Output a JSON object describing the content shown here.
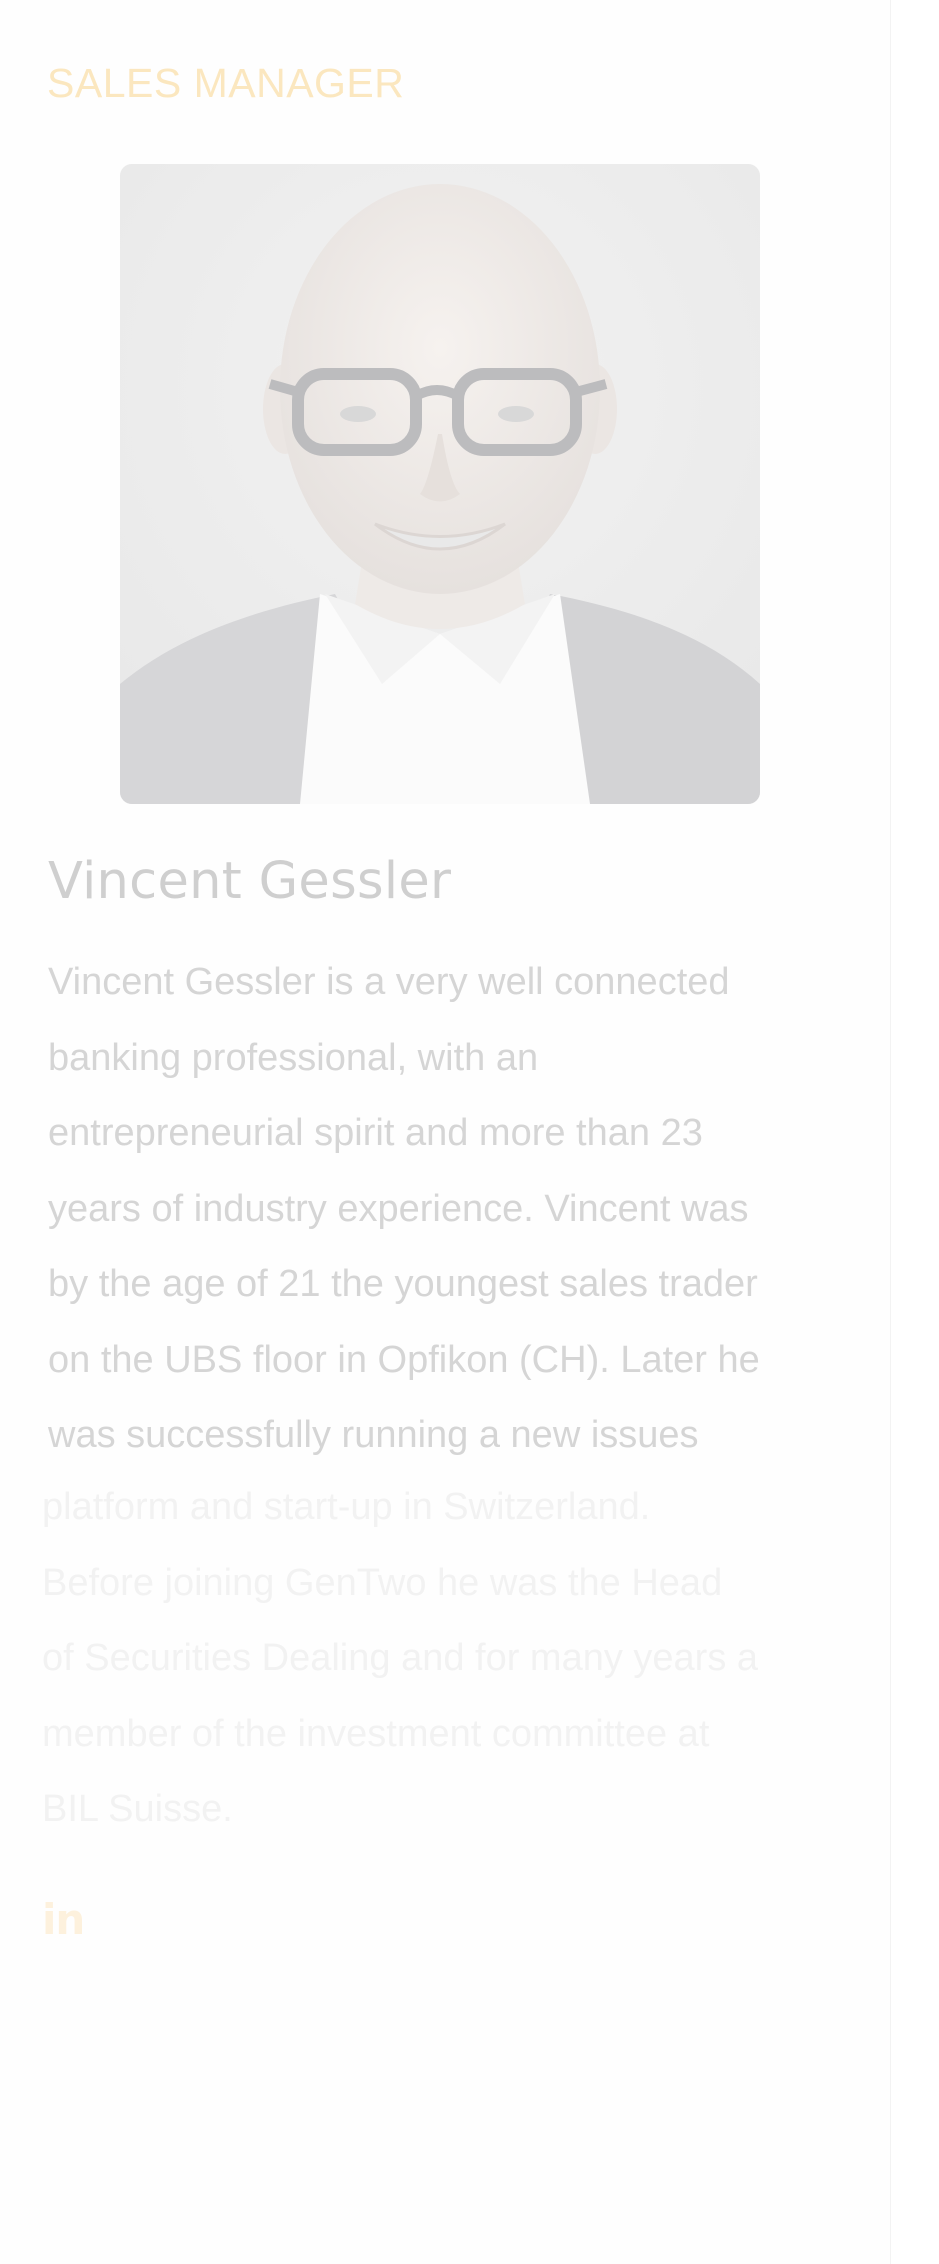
{
  "profile": {
    "role": "SALES MANAGER",
    "name": "Vincent Gessler",
    "photo_icon": "portrait-photo",
    "bio_visible_lines": [
      "Vincent Gessler is a very well connected",
      "banking professional, with an",
      "entrepreneurial spirit and more than 23",
      "years of industry experience. Vincent was",
      "by the age of 21 the youngest sales trader",
      "on the UBS floor in Opfikon (CH). Later he",
      "was successfully running a new issues"
    ],
    "bio_faded_lines": [
      "platform and start-up in Switzerland.",
      "Before joining GenTwo he was the Head",
      "of Securities Dealing and for many years a",
      "member of the investment committee at",
      "BIL Suisse."
    ],
    "social": {
      "linkedin_label": "in",
      "linkedin_icon": "linkedin-icon"
    }
  },
  "colors": {
    "role": "#fbe7bf",
    "name": "#cfcfcf",
    "bio_text": "#d5d5d5",
    "bio_faded": "#f2f2f2",
    "linkedin": "#fdf1dd",
    "background": "#fefefe"
  }
}
